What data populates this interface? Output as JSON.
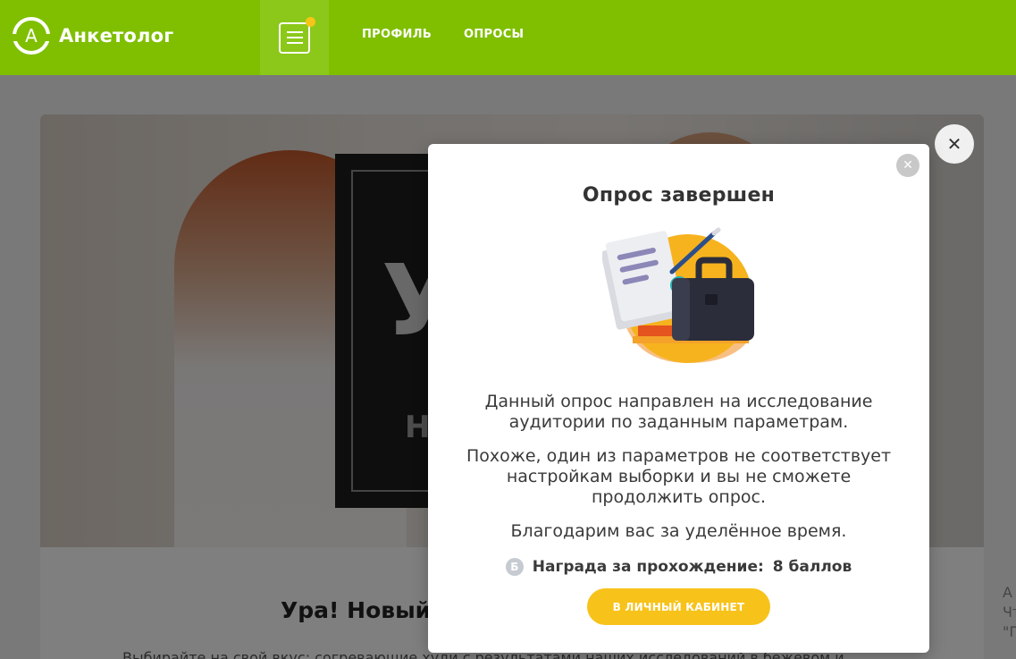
{
  "header": {
    "logo_letter": "А",
    "logo_text": "Анкетолог",
    "nav": [
      {
        "label": "ПРОФИЛЬ"
      },
      {
        "label": "ОПРОСЫ"
      }
    ]
  },
  "background_page": {
    "hero_letter": "У",
    "hero_letter2": "Н",
    "card_title": "Ура! Новый",
    "card_text": "Выбирайте на свой вкус: согревающие худи с результатами наших исследований в бежевом и",
    "right_peek_lines": [
      "А",
      "Чт",
      "\"Г"
    ]
  },
  "modal": {
    "title": "Опрос завершен",
    "paragraph1": "Данный опрос направлен на исследование аудитории по заданным параметрам.",
    "paragraph2": "Похоже, один из параметров не соответствует настройкам выборки и вы не сможете продолжить опрос.",
    "paragraph3": "Благодарим вас за уделённое время.",
    "reward_label": "Награда за прохождение:",
    "reward_value": "8 баллов",
    "coin_symbol": "Б",
    "button_label": "В ЛИЧНЫЙ КАБИНЕТ"
  },
  "colors": {
    "header_bg": "#7fbf00",
    "menu_dot": "#f5c518",
    "button_bg": "#f7c21a"
  }
}
